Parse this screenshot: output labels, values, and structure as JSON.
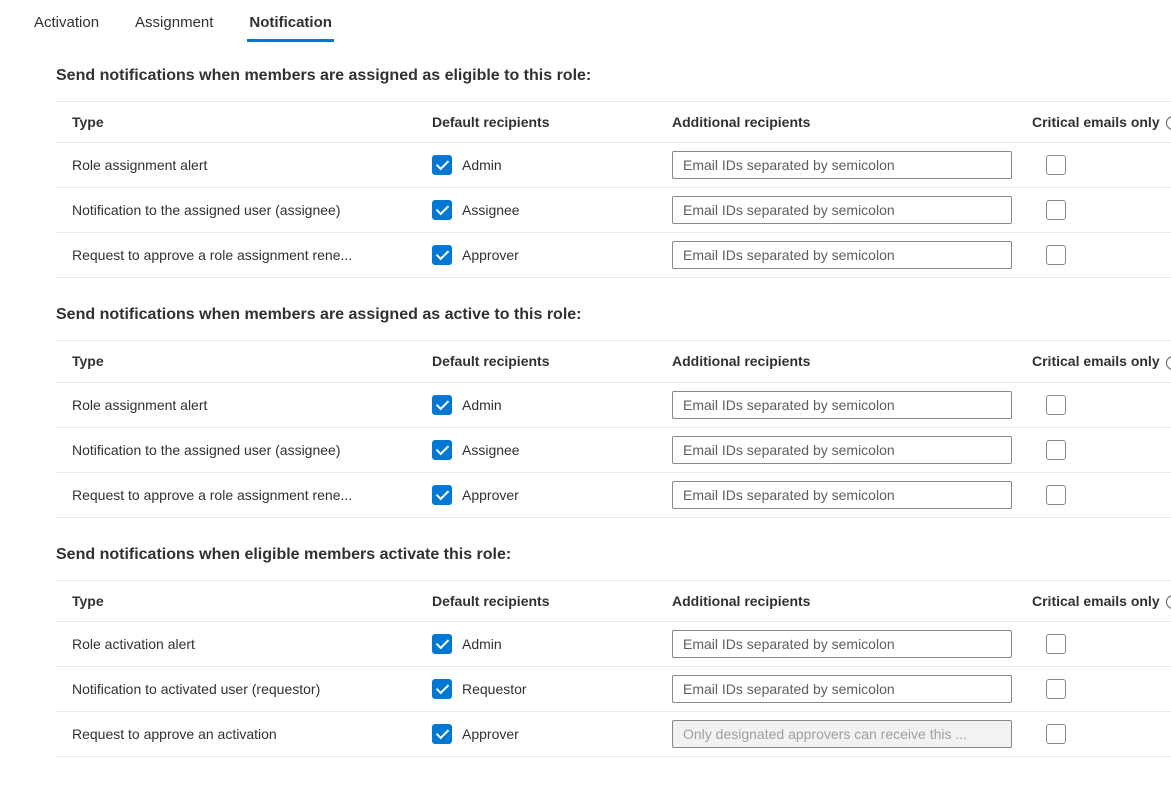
{
  "tabs": {
    "activation": "Activation",
    "assignment": "Assignment",
    "notification": "Notification"
  },
  "columns": {
    "type": "Type",
    "default_recipients": "Default recipients",
    "additional_recipients": "Additional recipients",
    "critical_emails_only": "Critical emails only"
  },
  "placeholders": {
    "email_ids": "Email IDs separated by semicolon",
    "designated_approvers": "Only designated approvers can receive this ..."
  },
  "sections": [
    {
      "title": "Send notifications when members are assigned as eligible to this role:",
      "rows": [
        {
          "type": "Role assignment alert",
          "default_checked": true,
          "recipient": "Admin",
          "placeholder_key": "email_ids",
          "critical_checked": false,
          "input_disabled": false
        },
        {
          "type": "Notification to the assigned user (assignee)",
          "default_checked": true,
          "recipient": "Assignee",
          "placeholder_key": "email_ids",
          "critical_checked": false,
          "input_disabled": false
        },
        {
          "type": "Request to approve a role assignment rene...",
          "default_checked": true,
          "recipient": "Approver",
          "placeholder_key": "email_ids",
          "critical_checked": false,
          "input_disabled": false
        }
      ]
    },
    {
      "title": "Send notifications when members are assigned as active to this role:",
      "rows": [
        {
          "type": "Role assignment alert",
          "default_checked": true,
          "recipient": "Admin",
          "placeholder_key": "email_ids",
          "critical_checked": false,
          "input_disabled": false
        },
        {
          "type": "Notification to the assigned user (assignee)",
          "default_checked": true,
          "recipient": "Assignee",
          "placeholder_key": "email_ids",
          "critical_checked": false,
          "input_disabled": false
        },
        {
          "type": "Request to approve a role assignment rene...",
          "default_checked": true,
          "recipient": "Approver",
          "placeholder_key": "email_ids",
          "critical_checked": false,
          "input_disabled": false
        }
      ]
    },
    {
      "title": "Send notifications when eligible members activate this role:",
      "rows": [
        {
          "type": "Role activation alert",
          "default_checked": true,
          "recipient": "Admin",
          "placeholder_key": "email_ids",
          "critical_checked": false,
          "input_disabled": false
        },
        {
          "type": "Notification to activated user (requestor)",
          "default_checked": true,
          "recipient": "Requestor",
          "placeholder_key": "email_ids",
          "critical_checked": false,
          "input_disabled": false
        },
        {
          "type": "Request to approve an activation",
          "default_checked": true,
          "recipient": "Approver",
          "placeholder_key": "designated_approvers",
          "critical_checked": false,
          "input_disabled": true
        }
      ]
    }
  ]
}
